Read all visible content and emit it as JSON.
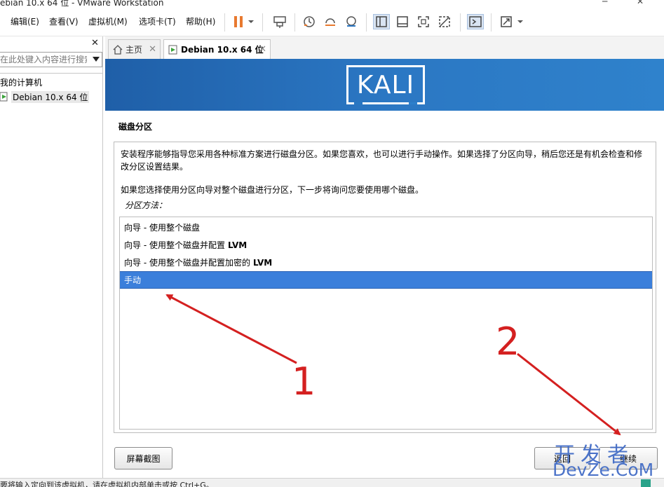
{
  "window": {
    "title": "ebian 10.x 64 位 - VMware Workstation"
  },
  "menu": [
    {
      "label": "编辑(E)"
    },
    {
      "label": "查看(V)"
    },
    {
      "label": "虚拟机(M)"
    },
    {
      "label": "选项卡(T)"
    },
    {
      "label": "帮助(H)"
    }
  ],
  "toolbar": {
    "icons": [
      "pause-icon",
      "dropdown-arrow-icon",
      "send-keys-icon",
      "snapshot-icon",
      "revert-snapshot-icon",
      "snapshot-manager-icon",
      "library-view-icon",
      "thumbnail-view-icon",
      "full-screen-icon",
      "unity-icon",
      "console-icon",
      "stretch-icon",
      "dropdown-arrow-icon"
    ],
    "accent": "#e8792f"
  },
  "sidebar": {
    "search_placeholder": "在此处键入内容进行搜索",
    "root_label": "我的计算机",
    "vm_label": "Debian 10.x 64 位"
  },
  "tabs": [
    {
      "label": "主页"
    },
    {
      "label": "Debian 10.x 64 位"
    }
  ],
  "installer": {
    "logo_text": "KALI",
    "page_title": "磁盘分区",
    "intro": "安装程序能够指导您采用各种标准方案进行磁盘分区。如果您喜欢，也可以进行手动操作。如果选择了分区向导，稍后您还是有机会检查和修改分区设置结果。",
    "question": "如果您选择使用分区向导对整个磁盘进行分区，下一步将询问您要使用哪个磁盘。",
    "method_label": "分区方法：",
    "options": [
      {
        "prefix": "向导 - 使用整个磁盘",
        "bold": ""
      },
      {
        "prefix": "向导 - 使用整个磁盘并配置",
        "bold": "LVM"
      },
      {
        "prefix": "向导 - 使用整个磁盘并配置加密的",
        "bold": "LVM"
      },
      {
        "prefix": "手动",
        "bold": ""
      }
    ],
    "selected_option": "手动",
    "screenshot_button": "屏幕截图",
    "back_button": "返回",
    "continue_button": "继续",
    "banner_color": "#2b77c3",
    "selection_color": "#3b7fdb"
  },
  "annotations": {
    "label_1": "1",
    "label_2": "2",
    "arrow_color": "#d42020"
  },
  "watermark": {
    "line1": "开发者",
    "line2": "DevZe.CoM"
  },
  "statusbar": {
    "message": "要将输入定向到该虚拟机，请在虚拟机内部单击或按 Ctrl+G。"
  }
}
